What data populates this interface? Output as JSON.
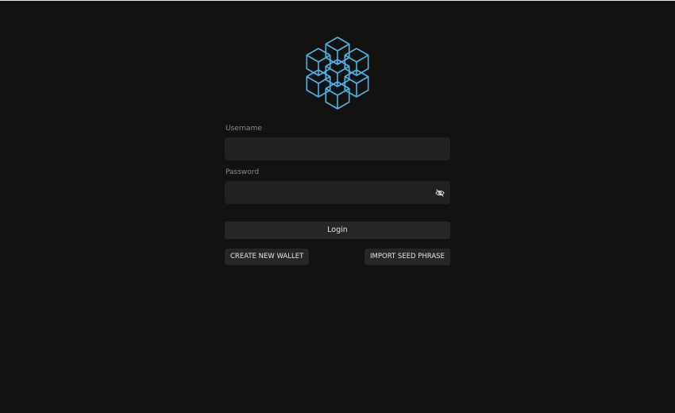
{
  "logo": {
    "icon": "hexagonal-cubes-logo-icon",
    "color": "#4fb3ea"
  },
  "username": {
    "label": "Username",
    "value": "",
    "placeholder": ""
  },
  "password": {
    "label": "Password",
    "value": "",
    "placeholder": "",
    "toggle_icon": "eye-slash-icon"
  },
  "actions": {
    "login_label": "Login",
    "create_wallet_label": "CREATE NEW WALLET",
    "import_seed_label": "IMPORT SEED PHRASE"
  },
  "colors": {
    "background": "#121210",
    "field_bg": "#212124",
    "button_bg": "#262629",
    "label": "#8d8d90",
    "accent": "#4fb3ea"
  }
}
